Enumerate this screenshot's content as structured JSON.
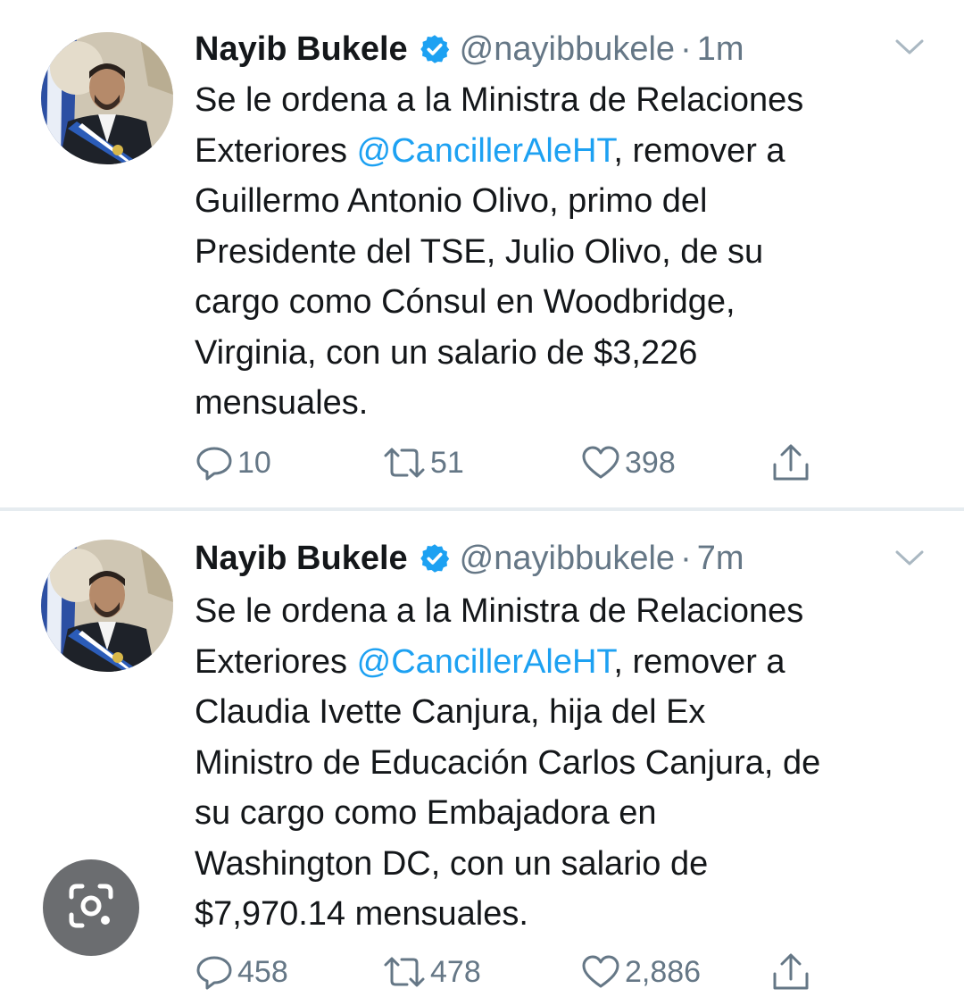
{
  "colors": {
    "text": "#14171a",
    "secondary": "#657786",
    "link": "#1da1f2",
    "verified": "#1da1f2",
    "divider": "#e6ecf0"
  },
  "tweets": [
    {
      "author": {
        "name": "Nayib Bukele",
        "handle": "@nayibbukele",
        "verified": true,
        "avatar_icon": "profile-photo"
      },
      "separator": "·",
      "time": "1m",
      "text_lines": [
        [
          "Se le ordena a la Ministra de Relaciones"
        ],
        [
          "Exteriores ",
          "@CancillerAleHT",
          ", remover a"
        ],
        [
          "Guillermo Antonio Olivo, primo del"
        ],
        [
          "Presidente del TSE, Julio Olivo, de su"
        ],
        [
          "cargo como Cónsul en Woodbridge,"
        ],
        [
          "Virginia, con un salario de $3,226"
        ],
        [
          "mensuales."
        ]
      ],
      "actions": {
        "replies": "10",
        "retweets": "51",
        "likes": "398",
        "share_icon": "share-icon"
      }
    },
    {
      "author": {
        "name": "Nayib Bukele",
        "handle": "@nayibbukele",
        "verified": true,
        "avatar_icon": "profile-photo"
      },
      "separator": "·",
      "time": "7m",
      "text_lines": [
        [
          "Se le ordena a la Ministra de Relaciones"
        ],
        [
          "Exteriores ",
          "@CancillerAleHT",
          ", remover a"
        ],
        [
          "Claudia Ivette Canjura, hija del Ex"
        ],
        [
          "Ministro de Educación Carlos Canjura, de"
        ],
        [
          "su cargo como Embajadora en"
        ],
        [
          "Washington DC, con un salario de"
        ],
        [
          "$7,970.14 mensuales."
        ]
      ],
      "actions": {
        "replies": "458",
        "retweets": "478",
        "likes": "2,886",
        "share_icon": "share-icon"
      }
    }
  ],
  "overlay": {
    "icon": "google-lens-icon"
  }
}
